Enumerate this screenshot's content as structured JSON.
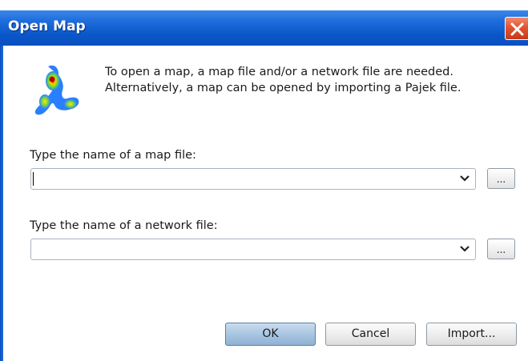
{
  "window": {
    "title": "Open Map"
  },
  "description": {
    "line1": "To open a map, a map file and/or a network file are needed.",
    "line2": "Alternatively, a map can be opened by importing a Pajek file."
  },
  "map_file": {
    "label": "Type the name of a map file:",
    "value": "",
    "browse_label": "..."
  },
  "network_file": {
    "label": "Type the name of a network file:",
    "value": "",
    "browse_label": "..."
  },
  "buttons": {
    "ok": "OK",
    "cancel": "Cancel",
    "import": "Import..."
  },
  "icons": {
    "close": "close-icon",
    "logo": "density-map-logo",
    "dropdown": "chevron-down-icon"
  },
  "colors": {
    "titlebar": "#0a56c8",
    "close": "#e2542f",
    "ok_button": "#a9c6e2"
  }
}
